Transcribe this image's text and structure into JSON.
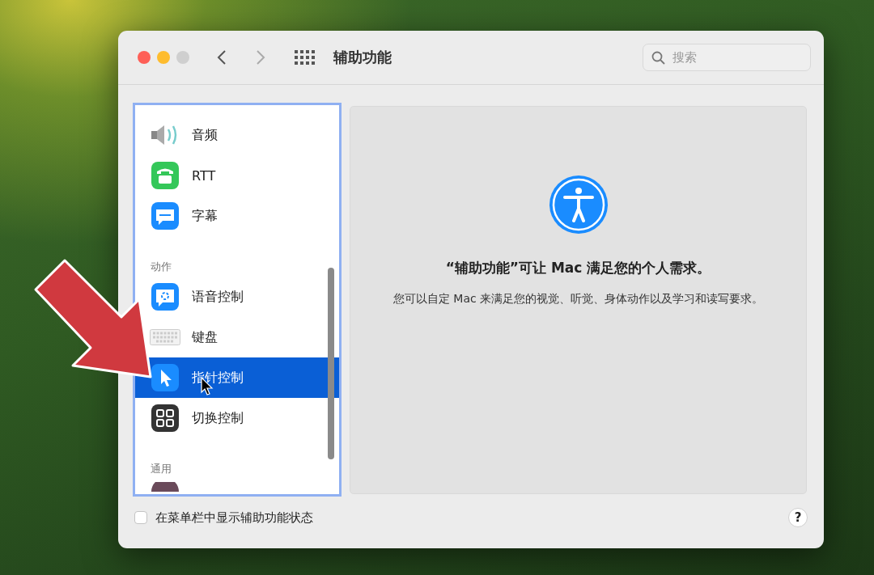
{
  "window": {
    "title": "辅助功能"
  },
  "search": {
    "placeholder": "搜索"
  },
  "sidebar": {
    "items": [
      {
        "kind": "item",
        "label": "音频",
        "selected": false
      },
      {
        "kind": "item",
        "label": "RTT",
        "selected": false
      },
      {
        "kind": "item",
        "label": "字幕",
        "selected": false
      },
      {
        "kind": "header",
        "label": "动作"
      },
      {
        "kind": "item",
        "label": "语音控制",
        "selected": false
      },
      {
        "kind": "item",
        "label": "键盘",
        "selected": false
      },
      {
        "kind": "item",
        "label": "指针控制",
        "selected": true
      },
      {
        "kind": "item",
        "label": "切换控制",
        "selected": false
      },
      {
        "kind": "header",
        "label": "通用"
      }
    ]
  },
  "panel": {
    "heading": "“辅助功能”可让 Mac 满足您的个人需求。",
    "body": "您可以自定 Mac 来满足您的视觉、听觉、身体动作以及学习和读写要求。"
  },
  "footer": {
    "checkbox": {
      "label": "在菜单栏中显示辅助功能状态",
      "checked": false
    },
    "help_button": "?"
  }
}
